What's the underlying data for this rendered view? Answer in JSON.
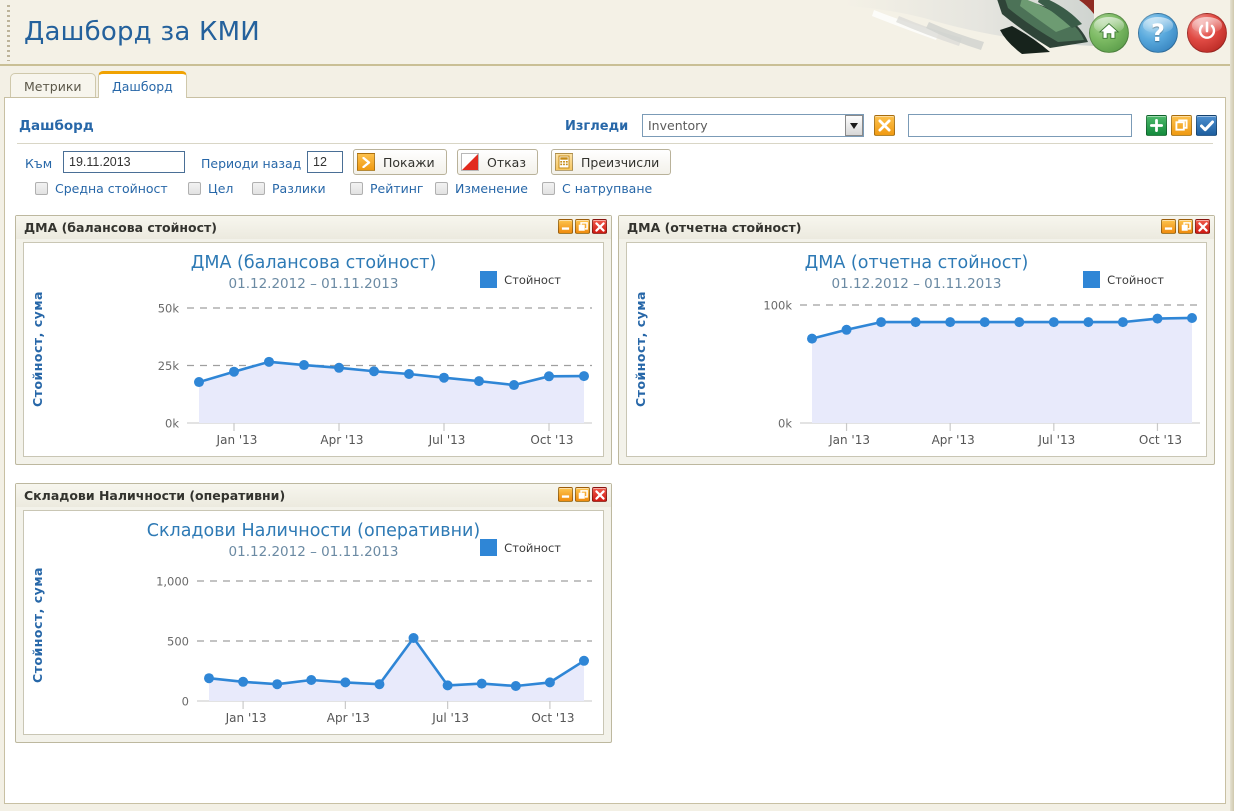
{
  "header": {
    "app_title": "Дашборд за КМИ",
    "buttons": [
      {
        "name": "home",
        "icon": "home-icon",
        "color": "#4e9140"
      },
      {
        "name": "help",
        "icon": "question-icon",
        "color": "#2a76b4"
      },
      {
        "name": "power",
        "icon": "power-icon",
        "color": "#ab1d18"
      }
    ]
  },
  "tabs": [
    {
      "label": "Метрики",
      "active": false
    },
    {
      "label": "Дашборд",
      "active": true
    }
  ],
  "filters": {
    "section_title": "Дашборд",
    "views_label": "Изгледи",
    "views_selected": "Inventory",
    "views_options": [
      "Inventory"
    ],
    "view_name_value": "",
    "clear_view_label": "X",
    "add_label": "+",
    "copy_label": "❐",
    "ok_label": "✔",
    "to_label": "Към",
    "date_value": "19.11.2013",
    "periods_label": "Периоди назад",
    "periods_value": "12",
    "buttons": [
      {
        "label": "Покажи",
        "icon": "arrow-right-icon"
      },
      {
        "label": "Отказ",
        "icon": "cancel-icon"
      },
      {
        "label": "Преизчисли",
        "icon": "calculator-icon"
      }
    ],
    "checkboxes": [
      {
        "label": "Средна стойност",
        "checked": false
      },
      {
        "label": "Цел",
        "checked": false
      },
      {
        "label": "Разлики",
        "checked": false
      },
      {
        "label": "Рейтинг",
        "checked": false
      },
      {
        "label": "Изменение",
        "checked": false
      },
      {
        "label": "С натрупване",
        "checked": false
      }
    ]
  },
  "panels": [
    {
      "title": "ДМА (балансова стойност)",
      "min": "–",
      "restore": "❐",
      "close": "✕"
    },
    {
      "title": "ДМА (отчетна стойност)",
      "min": "–",
      "restore": "❐",
      "close": "✕"
    },
    {
      "title": "Складови Наличности (оперативни)",
      "min": "–",
      "restore": "❐",
      "close": "✕"
    }
  ],
  "chart_data": [
    {
      "type": "area",
      "title": "ДМА (балансова стойност)",
      "subtitle": "01.12.2012 – 01.11.2013",
      "legend": [
        "Стойност"
      ],
      "legend_position": "top-right",
      "ylabel": "Стойност, сума",
      "xlabel": "",
      "grid": true,
      "ylim": [
        0,
        50000
      ],
      "yticks": [
        0,
        25000,
        50000
      ],
      "ytick_labels": [
        "0k",
        "25k",
        "50k"
      ],
      "x": [
        "Dec '12",
        "Jan '13",
        "Feb '13",
        "Mar '13",
        "Apr '13",
        "May '13",
        "Jun '13",
        "Jul '13",
        "Aug '13",
        "Sep '13",
        "Oct '13",
        "Nov '13"
      ],
      "xtick_labels": [
        "Jan '13",
        "Apr '13",
        "Jul '13",
        "Oct '13"
      ],
      "xtick_indices": [
        1,
        4,
        7,
        10
      ],
      "series": [
        {
          "name": "Стойност",
          "color": "#2f86d6",
          "values": [
            17800,
            22300,
            26600,
            25200,
            24000,
            22500,
            21300,
            19700,
            18200,
            16500,
            20300,
            20400
          ]
        }
      ]
    },
    {
      "type": "area",
      "title": "ДМА (отчетна стойност)",
      "subtitle": "01.12.2012 – 01.11.2013",
      "legend": [
        "Стойност"
      ],
      "legend_position": "top-right",
      "ylabel": "Стойност, сума",
      "xlabel": "",
      "grid": true,
      "ylim": [
        0,
        100000
      ],
      "yticks": [
        0,
        100000
      ],
      "ytick_labels": [
        "0k",
        "100k"
      ],
      "x": [
        "Dec '12",
        "Jan '13",
        "Feb '13",
        "Mar '13",
        "Apr '13",
        "May '13",
        "Jun '13",
        "Jul '13",
        "Aug '13",
        "Sep '13",
        "Oct '13",
        "Nov '13"
      ],
      "xtick_labels": [
        "Jan '13",
        "Apr '13",
        "Jul '13",
        "Oct '13"
      ],
      "xtick_indices": [
        1,
        4,
        7,
        10
      ],
      "series": [
        {
          "name": "Стойност",
          "color": "#2f86d6",
          "values": [
            71500,
            79000,
            85500,
            85500,
            85500,
            85500,
            85500,
            85500,
            85500,
            85500,
            88500,
            89000
          ]
        }
      ]
    },
    {
      "type": "area",
      "title": "Складови Наличности (оперативни)",
      "subtitle": "01.12.2012 – 01.11.2013",
      "legend": [
        "Стойност"
      ],
      "legend_position": "top-right",
      "ylabel": "Стойност, сума",
      "xlabel": "",
      "grid": true,
      "ylim": [
        0,
        1000
      ],
      "yticks": [
        0,
        500,
        1000
      ],
      "ytick_labels": [
        "0",
        "500",
        "1,000"
      ],
      "x": [
        "Dec '12",
        "Jan '13",
        "Feb '13",
        "Mar '13",
        "Apr '13",
        "May '13",
        "Jun '13",
        "Jul '13",
        "Aug '13",
        "Sep '13",
        "Oct '13",
        "Nov '13"
      ],
      "xtick_labels": [
        "Jan '13",
        "Apr '13",
        "Jul '13",
        "Oct '13"
      ],
      "xtick_indices": [
        1,
        4,
        7,
        10
      ],
      "series": [
        {
          "name": "Стойност",
          "color": "#2f86d6",
          "values": [
            190,
            160,
            140,
            175,
            155,
            140,
            525,
            130,
            145,
            125,
            155,
            335
          ]
        }
      ]
    }
  ]
}
